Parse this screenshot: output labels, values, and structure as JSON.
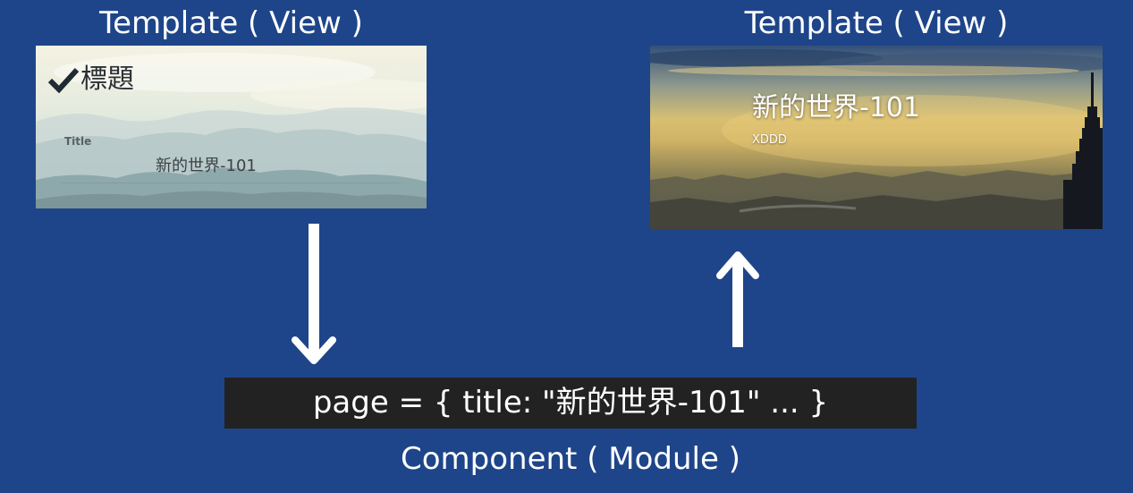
{
  "left_panel": {
    "heading": "Template ( View )",
    "form_heading": "標題",
    "field_label": "Title",
    "field_value": "新的世界-101"
  },
  "right_panel": {
    "heading": "Template ( View )",
    "title": "新的世界-101",
    "subtitle": "XDDD"
  },
  "component": {
    "code": "page = { title: \"新的世界-101\" ... }",
    "caption": "Component ( Module )"
  },
  "colors": {
    "background": "#1e4589",
    "code_bar": "#222222",
    "text": "#ffffff",
    "arrows": "#ffffff"
  },
  "icons": [
    "check-icon",
    "arrow-down-icon",
    "arrow-up-icon"
  ]
}
